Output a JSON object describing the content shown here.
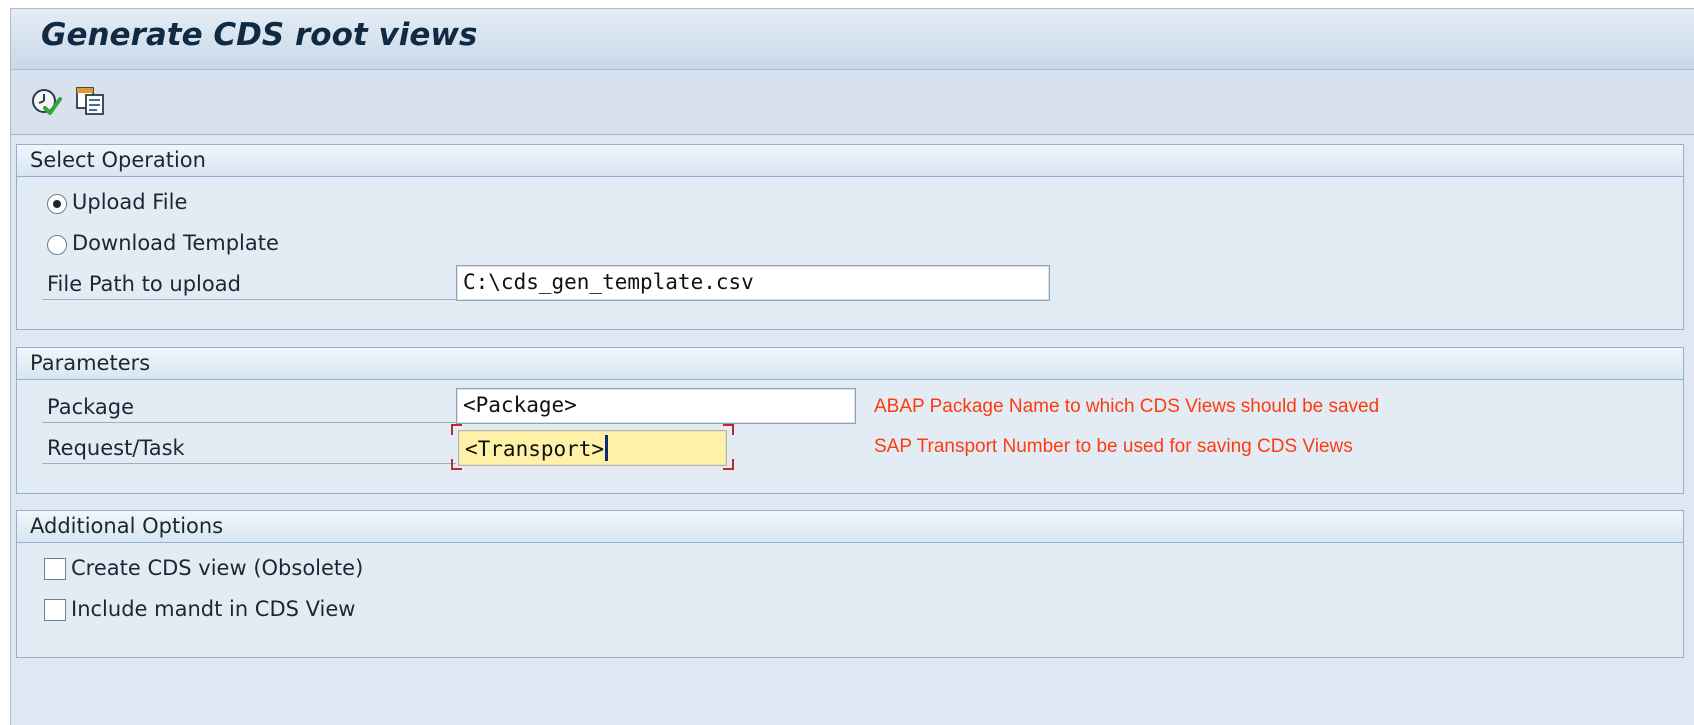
{
  "window": {
    "title": "Generate CDS root views"
  },
  "toolbar": {
    "execute_icon": "execute-icon",
    "variant_icon": "copy-variant-icon"
  },
  "select_operation": {
    "title": "Select Operation",
    "options": [
      {
        "label": "Upload File",
        "selected": true
      },
      {
        "label": "Download Template",
        "selected": false
      }
    ],
    "file_path": {
      "label": "File Path to upload",
      "value": "C:\\cds_gen_template.csv"
    }
  },
  "parameters": {
    "title": "Parameters",
    "package": {
      "label": "Package",
      "value": "<Package>",
      "note": "ABAP Package Name to which CDS Views should be saved"
    },
    "request": {
      "label": "Request/Task",
      "value": "<Transport>",
      "note": "SAP Transport Number to be used for saving CDS Views"
    }
  },
  "additional_options": {
    "title": "Additional Options",
    "options": [
      {
        "label": "Create CDS view (Obsolete)",
        "checked": false
      },
      {
        "label": "Include mandt in CDS View",
        "checked": false
      }
    ]
  },
  "colors": {
    "note": "#ff3b0e",
    "focus_field": "#fff2a8",
    "focus_marker": "#b52f2f",
    "title": "#102a43"
  }
}
